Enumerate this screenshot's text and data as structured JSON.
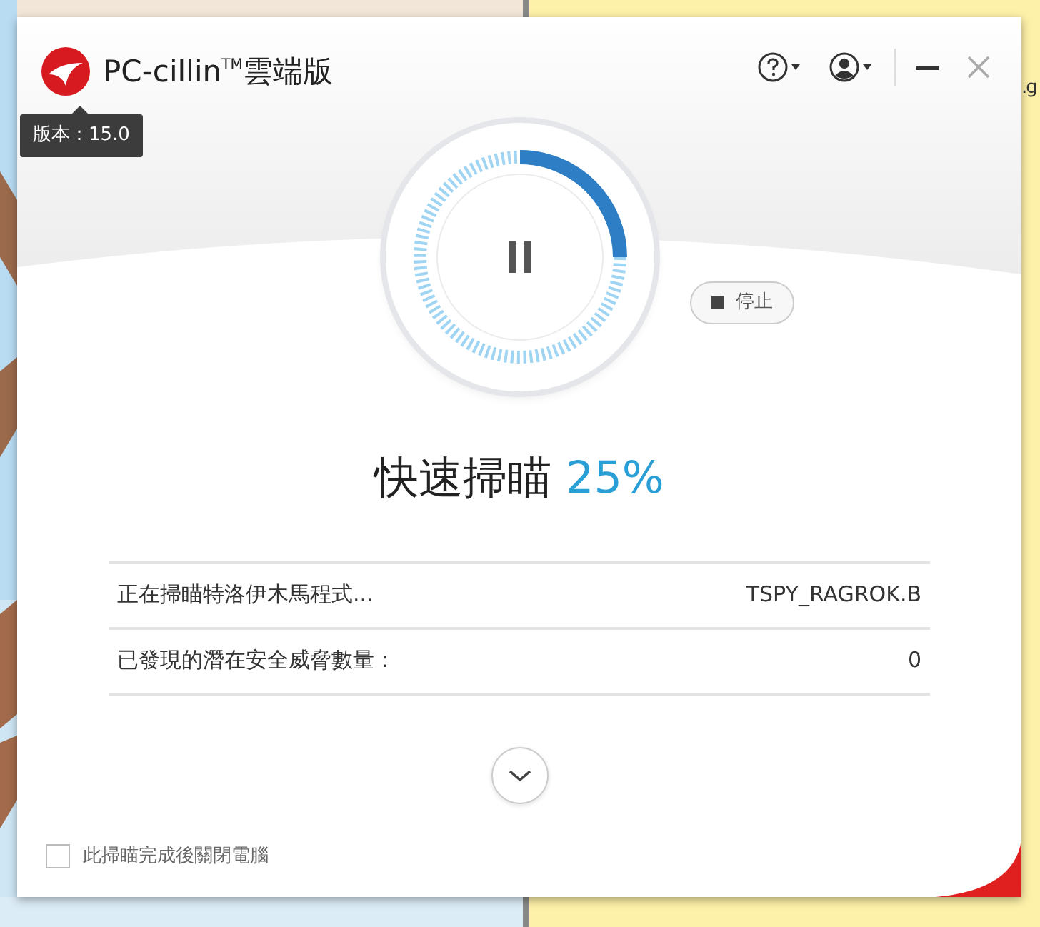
{
  "window": {
    "title": "PC-cillin$^{TM}$雲端版",
    "tooltip": "版本：15.0"
  },
  "scan": {
    "level": 0.25,
    "stop_label": "停止",
    "title": "快速掃瞄",
    "percent": "25%"
  },
  "details": [
    {
      "label": "正在掃瞄特洛伊木馬程式...",
      "value": "TSPY_RAGROK.B"
    },
    {
      "label": "已發現的潛在安全威脅數量：",
      "value": "0"
    }
  ],
  "shutdown_option": {
    "label": "此掃瞄完成後關閉電腦",
    "checked": false
  },
  "background_text": ".g"
}
